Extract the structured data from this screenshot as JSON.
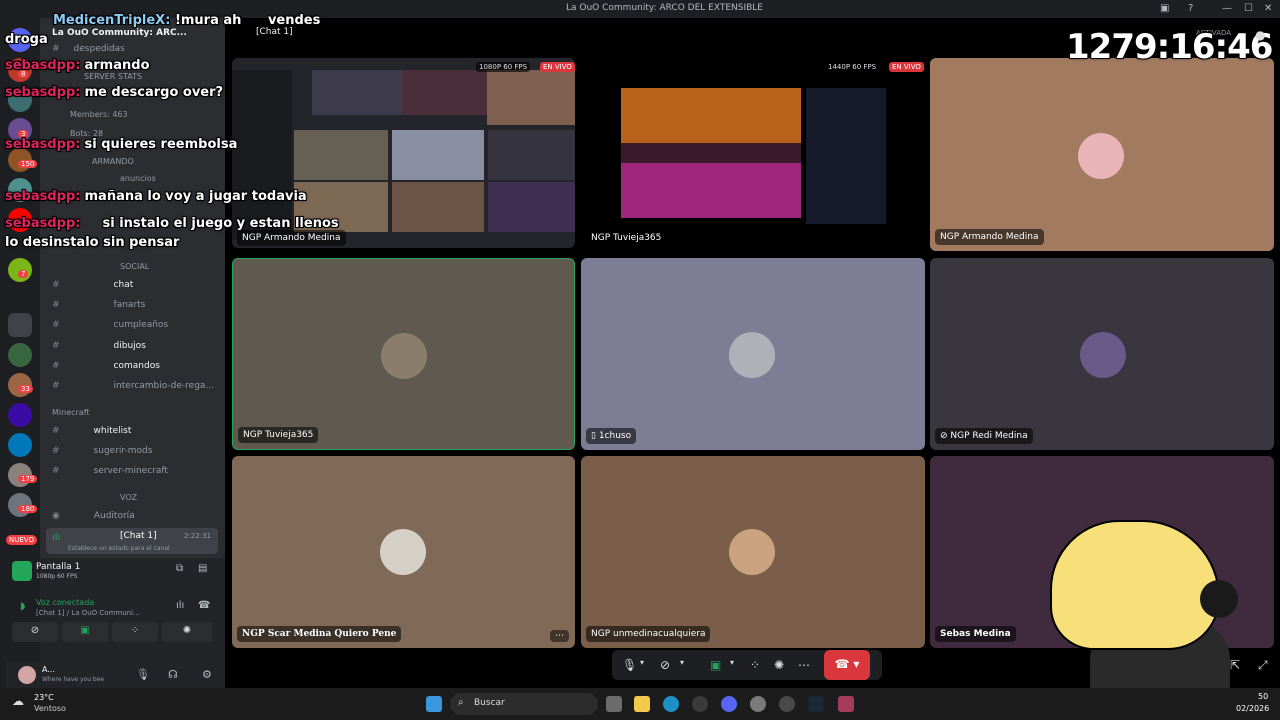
{
  "window": {
    "title": "La OuO Community: ARCO DEL EXTENSIBLE"
  },
  "server": {
    "name": "La OuO Community: ARC...",
    "stats_header": "SERVER STATS",
    "members": "Members: 463",
    "bots": "Bots: 28",
    "category_armando": "ARMANDO",
    "anuncios": "anuncios",
    "category_social": "SOCIAL",
    "category_minecraft": "Minecraft",
    "category_voz": "VOZ"
  },
  "channels": [
    {
      "name": "despedidas"
    },
    {
      "name": "chat"
    },
    {
      "name": "fanarts"
    },
    {
      "name": "cumpleaños"
    },
    {
      "name": "dibujos"
    },
    {
      "name": "comandos"
    },
    {
      "name": "intercambio-de-rega..."
    },
    {
      "name": "whitelist"
    },
    {
      "name": "sugerir-mods"
    },
    {
      "name": "server-minecraft"
    }
  ],
  "voice": {
    "auditoria": "Auditoría",
    "active_channel": "[Chat 1]",
    "timer": "2:22:31",
    "status_hint": "Establece un estado para el canal",
    "new_label": "NUEVO"
  },
  "screen_share": {
    "label": "Pantalla 1",
    "quality": "1080p 60 FPS"
  },
  "voice_conn": {
    "status": "Voz conectada",
    "detail": "[Chat 1] / La OuO Communi..."
  },
  "user": {
    "name": "A...",
    "status": "Where have you bee"
  },
  "header": {
    "channel": "[Chat 1]",
    "activated": "ACTIVADA"
  },
  "tiles": [
    {
      "name": "NGP Armando Medina",
      "badge_q": "1080P 60 FPS",
      "badge_live": "EN VIVO"
    },
    {
      "name": "NGP Tuvieja365",
      "badge_q": "1440P 60 FPS",
      "badge_live": "EN VIVO"
    },
    {
      "name": "NGP Armando Medina"
    },
    {
      "name": "NGP Tuvieja365"
    },
    {
      "name": "1chuso"
    },
    {
      "name": "NGP Redi Medina"
    },
    {
      "name": "NGP Scar Medina Quiero Pene"
    },
    {
      "name": "NGP unmedinacualquiera"
    },
    {
      "name": "Sebas Medina"
    }
  ],
  "stream_timer": "1279:16:46",
  "chat_overlay": [
    {
      "user": "MedicenTripleX:",
      "text": "!mura ah",
      "extra": "vendes"
    },
    {
      "user": "",
      "text": "droga"
    },
    {
      "user": "sebasdpp:",
      "text": "armando"
    },
    {
      "user": "sebasdpp:",
      "text": "me descargo over?"
    },
    {
      "user": "sebasdpp:",
      "text": "si quieres reembolsa"
    },
    {
      "user": "sebasdpp:",
      "text": "mañana lo voy a jugar todavia"
    },
    {
      "user": "sebasdpp:",
      "text": "si instalo el juego y estan llenos"
    },
    {
      "user": "",
      "text": "lo desinstalo sin pensar"
    }
  ],
  "taskbar": {
    "weather_temp": "23°C",
    "weather_desc": "Ventoso",
    "search": "Buscar",
    "time": "50",
    "date": "02/2026",
    "rail_badges": [
      "8",
      "3",
      "150",
      "7",
      "2",
      "33",
      "179",
      "180",
      "2"
    ]
  },
  "colors": {
    "accent": "#23a55a",
    "danger": "#da373c",
    "brand": "#5865f2"
  }
}
